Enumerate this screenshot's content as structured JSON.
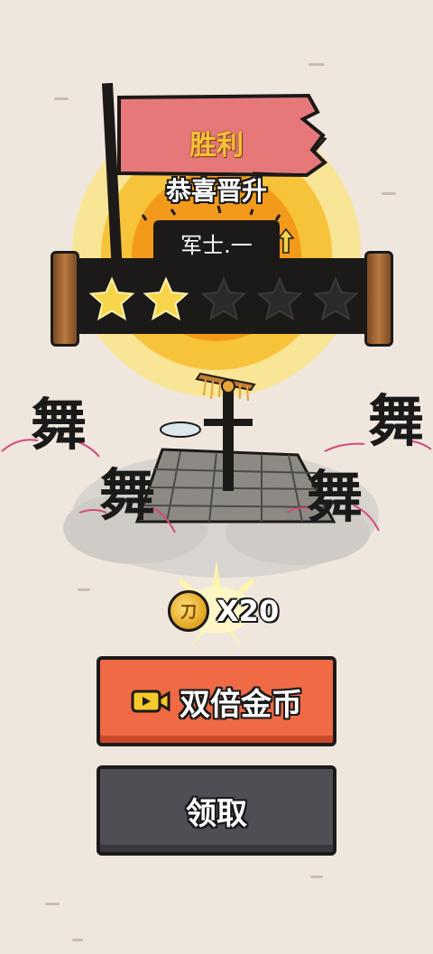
{
  "result": {
    "title": "胜利",
    "subtitle": "恭喜晋升",
    "rank": "军士.一",
    "stars_earned": 2,
    "stars_total": 5
  },
  "scene": {
    "dance_characters": [
      "舞",
      "舞",
      "舞",
      "舞"
    ]
  },
  "reward": {
    "coin_glyph": "刀",
    "amount_label": "X20"
  },
  "buttons": {
    "double": "双倍金币",
    "claim": "领取"
  },
  "colors": {
    "background": "#efe6dd",
    "flag": "#e6787a",
    "sun_outer": "#f9e596",
    "sun_mid": "#f7c33a",
    "sun_inner": "#f39a1c",
    "star_on": "#f6d54a",
    "star_off": "#2b2a29",
    "double_button": "#ef6a45",
    "claim_button": "#4d4f55"
  }
}
